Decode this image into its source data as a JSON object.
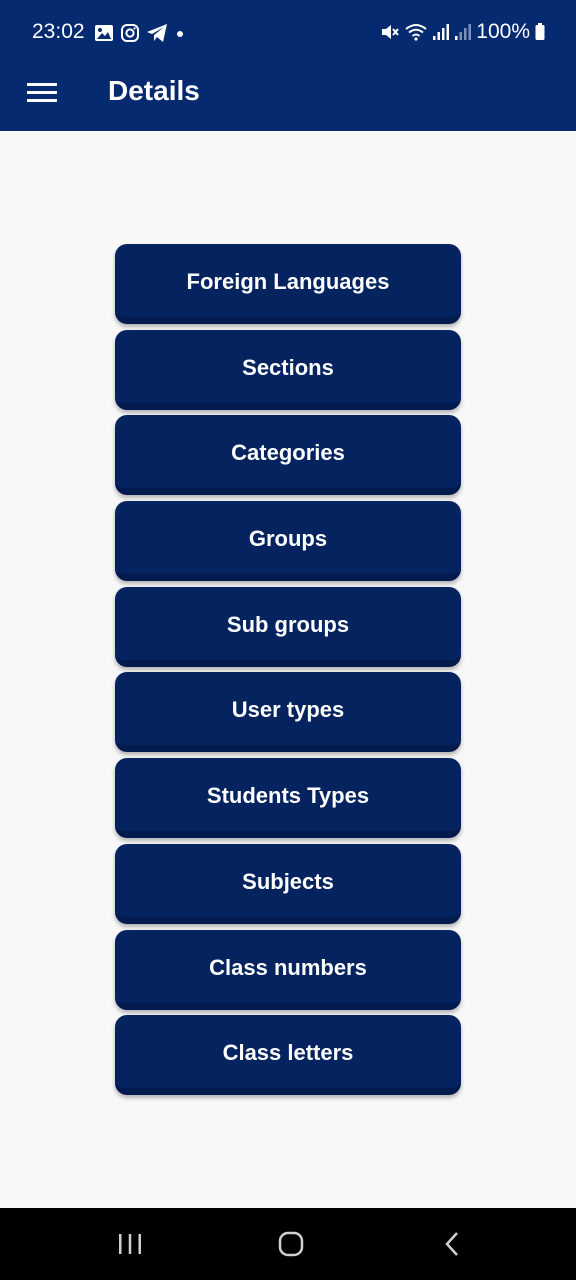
{
  "status_bar": {
    "time": "23:02",
    "battery": "100%"
  },
  "app_bar": {
    "title": "Details"
  },
  "buttons": [
    "Foreign Languages",
    "Sections",
    "Categories",
    "Groups",
    "Sub groups",
    "User types",
    "Students Types",
    "Subjects",
    "Class numbers",
    "Class letters"
  ],
  "colors": {
    "primary": "#062a70",
    "button": "#05245f",
    "background": "#f8f8f9",
    "nav_bar": "#000000"
  }
}
